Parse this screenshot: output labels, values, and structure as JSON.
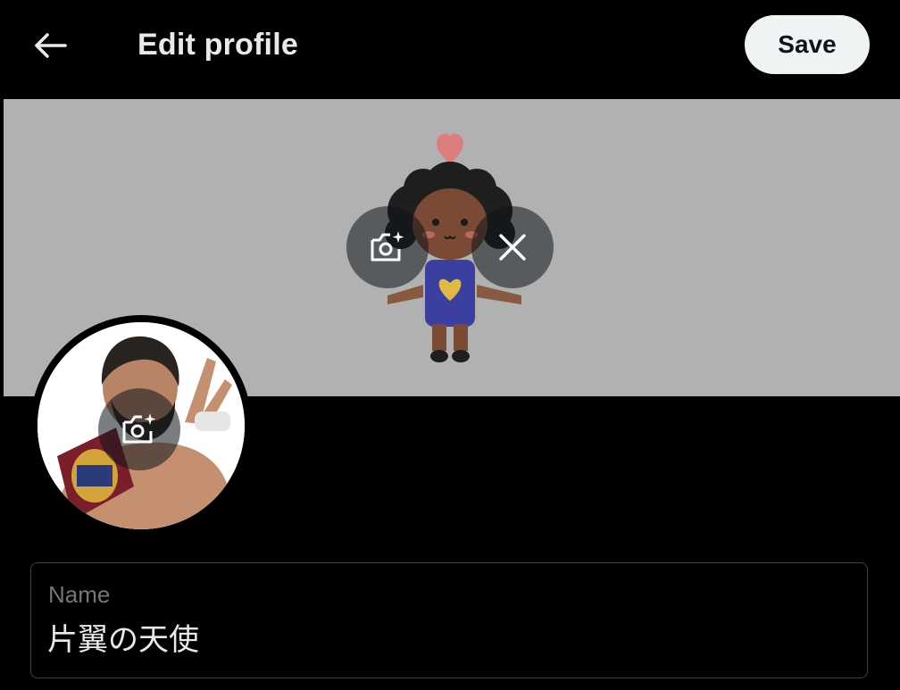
{
  "header": {
    "back_icon": "arrow-left-icon",
    "title": "Edit profile",
    "save_label": "Save"
  },
  "banner": {
    "background_color": "#b1b1b1",
    "image": "chibi-character-with-heart",
    "camera_icon": "camera-add-icon",
    "remove_icon": "close-icon"
  },
  "avatar": {
    "image": "profile-photo-wrestler",
    "camera_icon": "camera-add-icon"
  },
  "form": {
    "name_label": "Name",
    "name_value": "片翼の天使"
  },
  "colors": {
    "background": "#000000",
    "text_primary": "#e7e9ea",
    "text_secondary": "#71767b",
    "save_button_bg": "#eff3f4",
    "field_border": "#3e4144"
  }
}
